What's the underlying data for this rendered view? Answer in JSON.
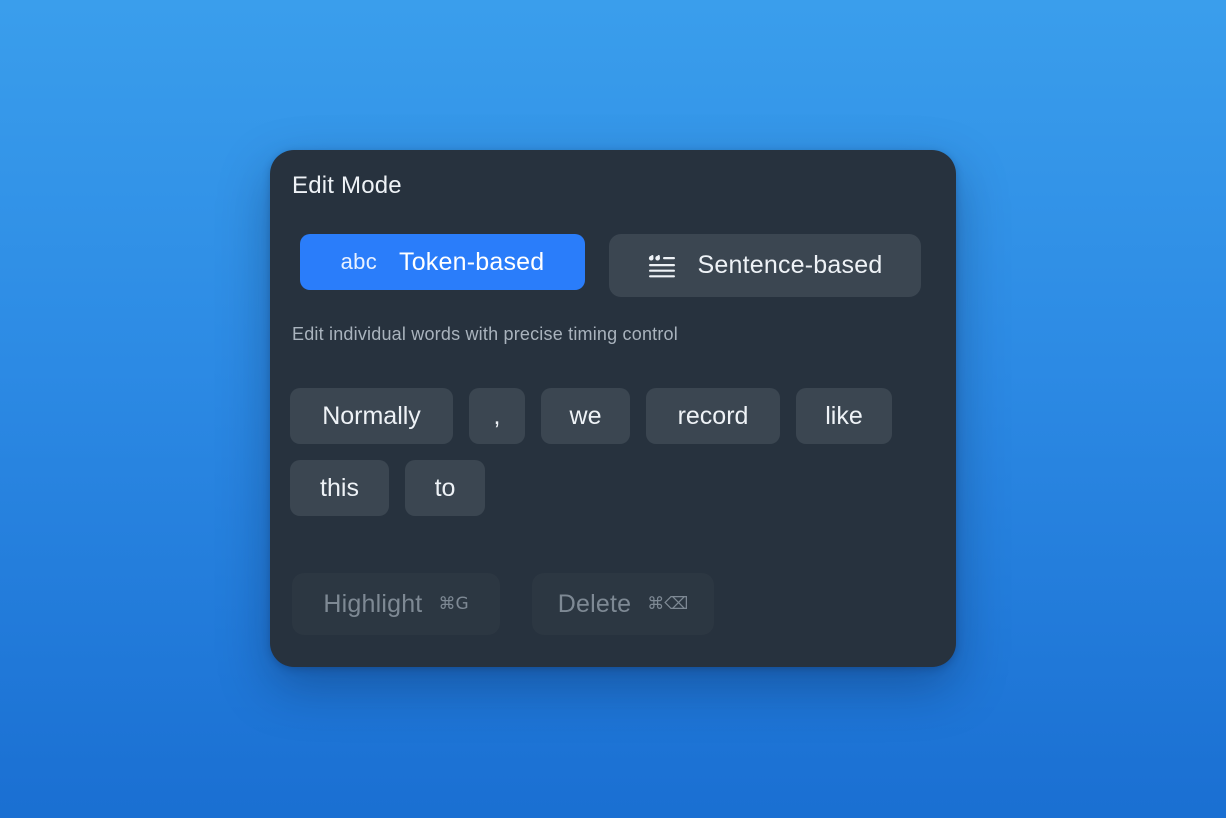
{
  "panel": {
    "title": "Edit Mode",
    "modes": [
      {
        "icon": "abc",
        "icon_name": "abc-text-icon",
        "label": "Token-based",
        "selected": true
      },
      {
        "icon": "",
        "icon_name": "quote-lines-icon",
        "label": "Sentence-based",
        "selected": false
      }
    ],
    "hint": "Edit individual words with precise timing control",
    "tokens": [
      "Normally",
      ",",
      "we",
      "record",
      "like",
      "this",
      "to"
    ],
    "actions": [
      {
        "label": "Highlight",
        "shortcut": "⌘G",
        "enabled": false
      },
      {
        "label": "Delete",
        "shortcut": "⌘⌫",
        "enabled": false
      }
    ]
  },
  "colors": {
    "accent": "#2a7dfa",
    "panel_bg": "#27323e",
    "chip_bg": "#3b4651",
    "disabled_text": "#7e8994"
  }
}
